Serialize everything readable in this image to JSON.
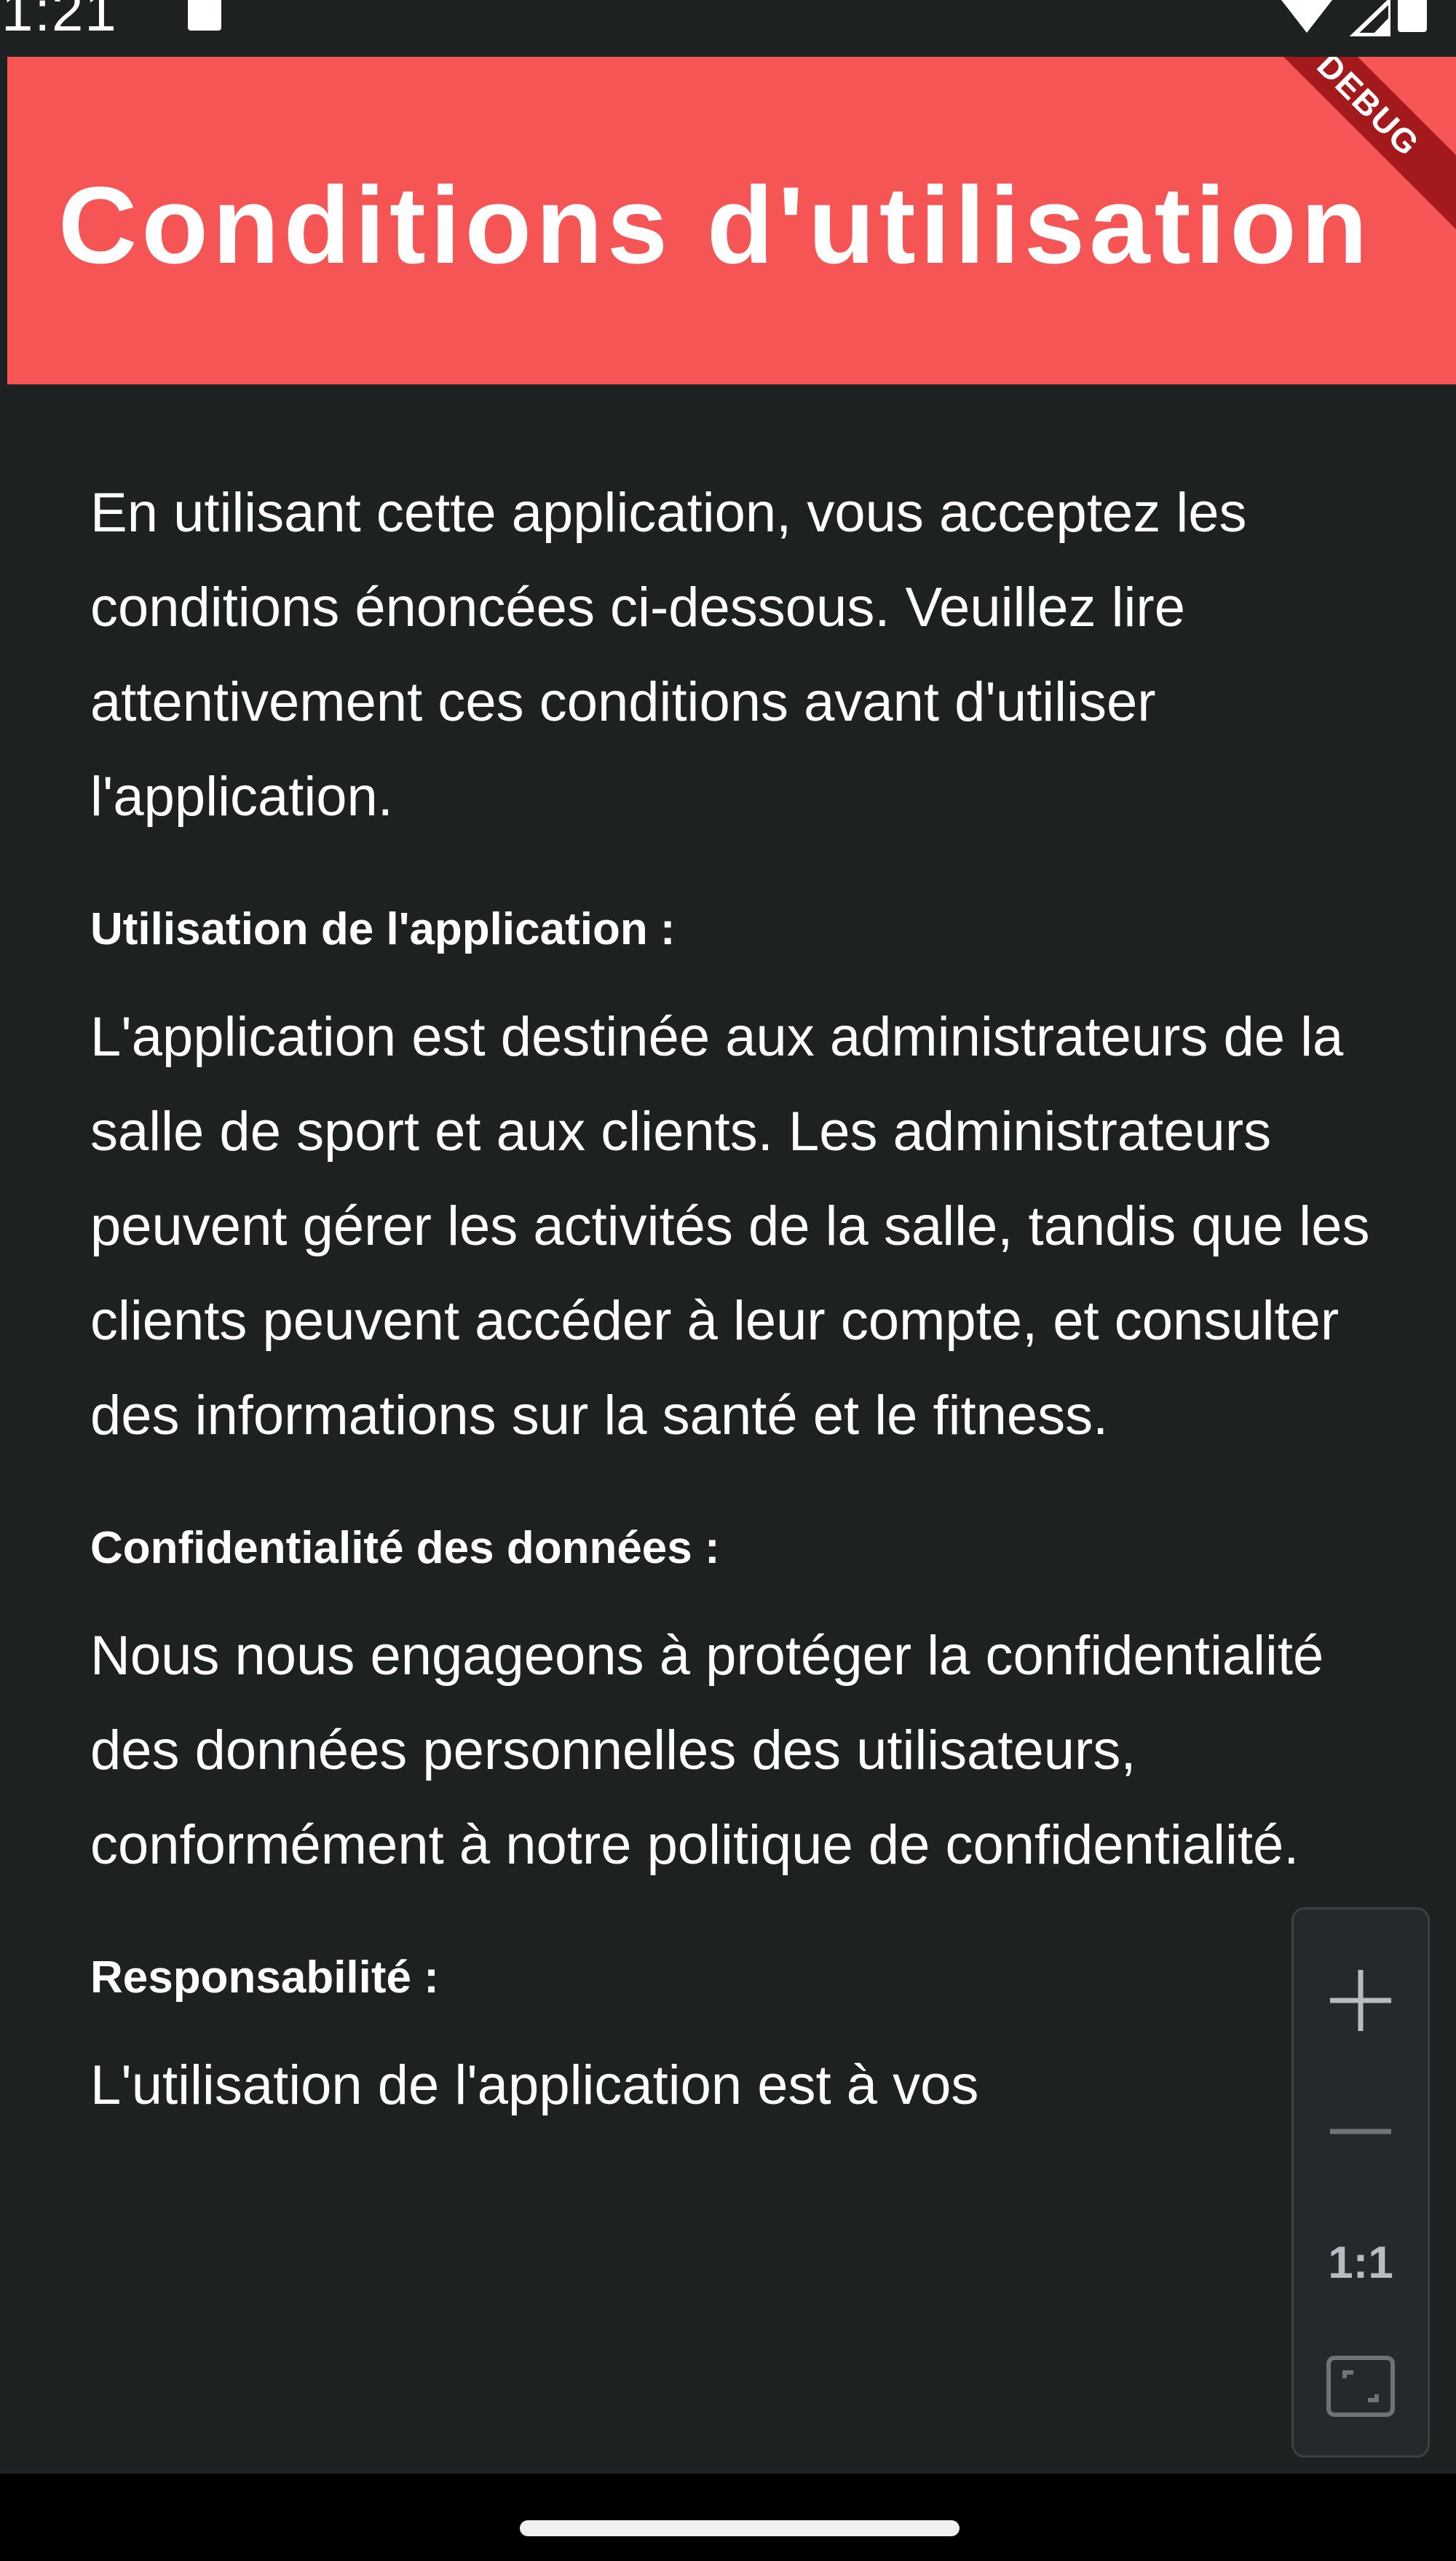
{
  "status_bar": {
    "time": "1:21",
    "icons": [
      "sd-card-icon",
      "wifi-icon",
      "signal-icon",
      "battery-icon"
    ]
  },
  "app_bar": {
    "title": "Conditions d'utilisation",
    "debug_label": "DEBUG",
    "color": "#f65556"
  },
  "content": {
    "intro": "En utilisant cette application, vous acceptez les conditions énoncées ci-dessous. Veuillez lire attentivement ces conditions avant d'utiliser l'application.",
    "sections": [
      {
        "heading": "Utilisation de l'application :",
        "body": "L'application est destinée aux administrateurs de la salle de sport et aux clients. Les administrateurs peuvent gérer les activités de la salle, tandis que les clients peuvent accéder à leur compte, et consulter des informations sur la santé et le fitness."
      },
      {
        "heading": "Confidentialité des données :",
        "body": "Nous nous engageons à protéger la confidentialité des données personnelles des utilisateurs, conformément à notre politique de confidentialité."
      },
      {
        "heading": "Responsabilité :",
        "body": "L'utilisation de l'application est à vos"
      }
    ]
  },
  "zoom_controls": {
    "zoom_in_icon": "plus-icon",
    "zoom_out_icon": "minus-icon",
    "reset_label": "1:1",
    "fit_icon": "fit-screen-icon"
  },
  "colors": {
    "background": "#1e2122",
    "accent": "#f65556",
    "text": "#ffffff"
  }
}
